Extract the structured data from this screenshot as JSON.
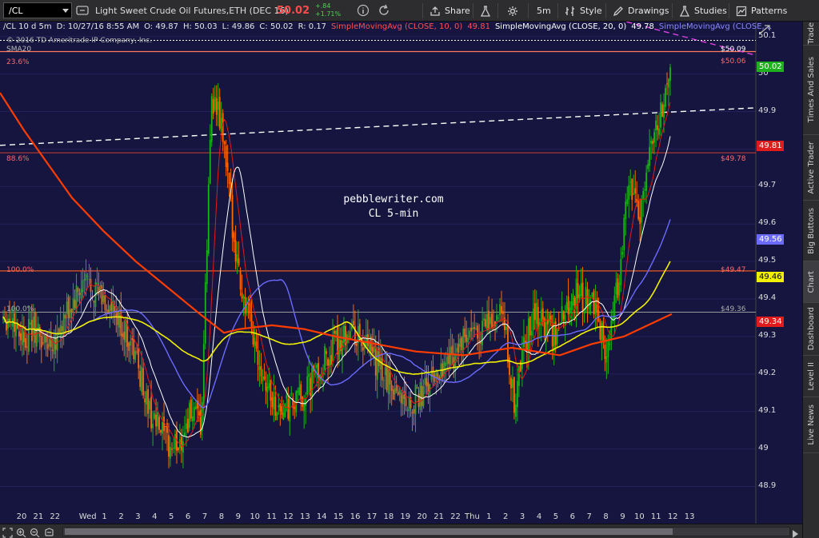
{
  "toolbar": {
    "symbol": "/CL",
    "instrument": "Light Sweet Crude Oil Futures,ETH (DEC 16)",
    "last_price": "50.02",
    "change": "+.84",
    "change_pct": "+1.71%",
    "share_label": "Share",
    "timeframe_label": "5m",
    "style_label": "Style",
    "drawings_label": "Drawings",
    "studies_label": "Studies",
    "patterns_label": "Patterns"
  },
  "info": {
    "spec": "/CL 10 d 5m",
    "date": "D: 10/27/16 8:55 AM",
    "open": "O: 49.87",
    "high": "H: 50.03",
    "low": "L: 49.86",
    "close": "C: 50.02",
    "range": "R: 0.17",
    "sma10_name": "SimpleMovingAvg (CLOSE, 10, 0)",
    "sma10_val": "49.81",
    "sma20_name": "SimpleMovingAvg (CLOSE, 20, 0)",
    "sma20_val": "49.78",
    "sma50_name": "SimpleMovingAvg (CLOSE,..."
  },
  "copyright": "© 2016 TD Ameritrade IP Company, Inc.",
  "sma_label": "SMA20",
  "watermark": {
    "line1": "pebblewriter.com",
    "line2": "CL 5-min"
  },
  "fib": {
    "l236": "23.6%",
    "l886": "88.6%",
    "l100a": "100.0%",
    "l100b": "100.0%"
  },
  "right_labels": {
    "r5009": "$50.09",
    "r5006": "$50.06",
    "r4978": "$49.78",
    "r4947": "$49.47",
    "r4936": "$49.36"
  },
  "y_axis": [
    "50.1",
    "50",
    "49.9",
    "49.8",
    "49.7",
    "49.6",
    "49.5",
    "49.4",
    "49.3",
    "49.2",
    "49.1",
    "49",
    "48.9"
  ],
  "badges": [
    {
      "text": "50.02",
      "bg": "#1db21d",
      "fg": "#ffffff",
      "price": 50.02
    },
    {
      "text": "49.81",
      "bg": "#e01b1b",
      "fg": "#ffffff",
      "price": 49.81
    },
    {
      "text": "49.56",
      "bg": "#6b6bff",
      "fg": "#ffffff",
      "price": 49.56
    },
    {
      "text": "49.46",
      "bg": "#f0f000",
      "fg": "#000000",
      "price": 49.46
    },
    {
      "text": "49.34",
      "bg": "#e01b1b",
      "fg": "#ffffff",
      "price": 49.34
    }
  ],
  "x_axis": [
    "20",
    "21",
    "22",
    "Wed",
    "1",
    "2",
    "3",
    "4",
    "5",
    "6",
    "7",
    "8",
    "9",
    "10",
    "11",
    "12",
    "13",
    "14",
    "15",
    "16",
    "17",
    "18",
    "19",
    "20",
    "21",
    "22",
    "Thu",
    "1",
    "2",
    "3",
    "4",
    "5",
    "6",
    "7",
    "8",
    "9",
    "10",
    "11",
    "12",
    "13"
  ],
  "sidebar": [
    "Trade",
    "Times And Sales",
    "Active Trader",
    "Big Buttons",
    "Chart",
    "Dashboard",
    "Level II",
    "Live News"
  ],
  "colors": {
    "bg": "#15153f",
    "sma10": "#e01b1b",
    "sma20": "#ffffff",
    "sma50": "#6b6bff",
    "sma_yellow": "#f0f000",
    "sma_orange": "#ff3c00",
    "up": "#1db21d",
    "down": "#ff6a00",
    "fib": "#e85a20",
    "trend": "#ffffff",
    "trend_pink": "#e040e0"
  },
  "chart_data": {
    "type": "candlestick",
    "y_range": [
      48.85,
      50.14
    ],
    "close_series": [
      49.36,
      49.34,
      49.3,
      49.32,
      49.28,
      49.3,
      49.35,
      49.4,
      49.45,
      49.42,
      49.38,
      49.34,
      49.3,
      49.22,
      49.1,
      49.05,
      49.0,
      49.02,
      49.1,
      49.05,
      49.95,
      49.85,
      49.6,
      49.4,
      49.3,
      49.2,
      49.12,
      49.1,
      49.12,
      49.15,
      49.2,
      49.24,
      49.28,
      49.32,
      49.3,
      49.26,
      49.22,
      49.18,
      49.15,
      49.12,
      49.14,
      49.18,
      49.22,
      49.25,
      49.28,
      49.3,
      49.32,
      49.34,
      49.35,
      49.12,
      49.28,
      49.36,
      49.34,
      49.3,
      49.38,
      49.42,
      49.4,
      49.36,
      49.25,
      49.45,
      49.72,
      49.6,
      49.82,
      49.88,
      50.02
    ]
  }
}
